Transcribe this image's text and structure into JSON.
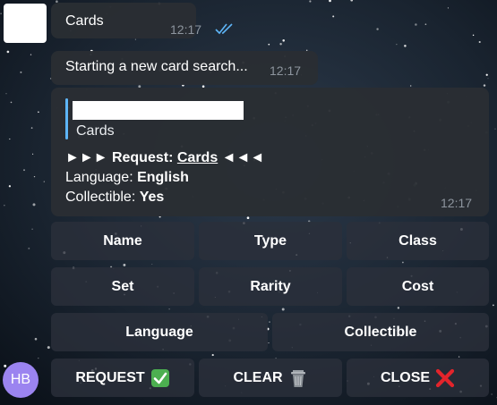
{
  "messages": {
    "first": {
      "text": "Cards",
      "time": "12:17"
    },
    "second": {
      "text": "Starting a new card search...",
      "time": "12:17"
    },
    "third": {
      "quote_text": "Cards",
      "request_prefix": "►►► Request: ",
      "request_value": "Cards",
      "request_suffix": " ◄◄◄",
      "language_label": "Language: ",
      "language_value": "English",
      "collectible_label": "Collectible: ",
      "collectible_value": "Yes",
      "time": "12:17"
    }
  },
  "keyboard": {
    "row1": [
      "Name",
      "Type",
      "Class"
    ],
    "row2": [
      "Set",
      "Rarity",
      "Cost"
    ],
    "row3": [
      "Language",
      "Collectible"
    ],
    "row4": [
      "REQUEST",
      "CLEAR",
      "CLOSE"
    ]
  },
  "user_avatar": {
    "initials": "HB",
    "color": "#9b84f0"
  },
  "colors": {
    "bubble": "#2a2e33",
    "accent": "#5eb5f7",
    "time": "#8d959e"
  }
}
